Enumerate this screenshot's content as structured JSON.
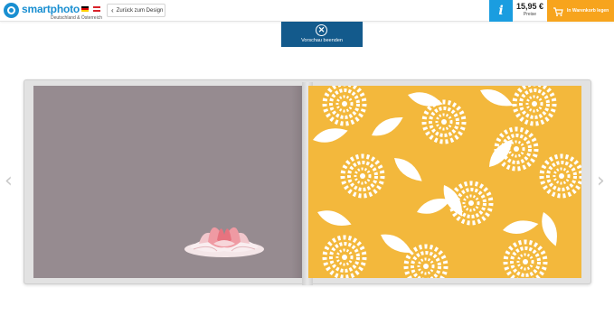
{
  "header": {
    "logo_name": "smartphoto",
    "logo_subtitle": "Deutschland & Österreich",
    "back_label": "Zurück zum Design",
    "info_symbol": "i",
    "price_value": "15,95 €",
    "price_label": "Preise",
    "cart_label": "In Warenkorb legen"
  },
  "preview": {
    "close_symbol": "✕",
    "end_label": "Vorschau beenden"
  },
  "navigation": {
    "prev_symbol": "‹",
    "next_symbol": "›"
  },
  "colors": {
    "brand_blue": "#1a8fd1",
    "info_blue": "#1a9de0",
    "cart_orange": "#f7a41d",
    "preview_navy": "#135a8c",
    "left_page": "#968b90",
    "right_page_pattern": "#f3b83c"
  },
  "icons": {
    "logo": "smartphoto-logo-icon",
    "back": "chevron-left-icon",
    "info": "info-icon",
    "cart": "cart-icon",
    "close": "close-circle-icon",
    "prev": "chevron-left-icon",
    "next": "chevron-right-icon"
  }
}
